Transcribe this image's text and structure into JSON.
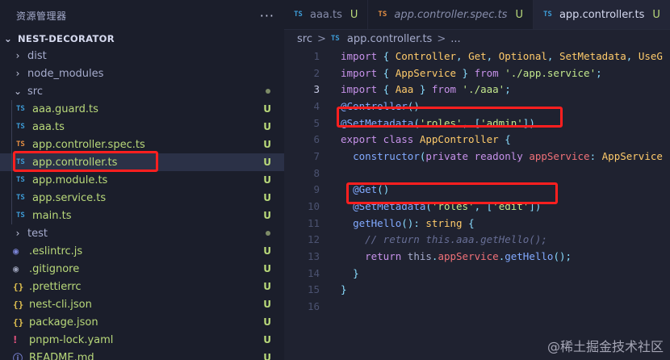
{
  "sidebar": {
    "title": "资源管理器",
    "more": "···",
    "project": "NEST-DECORATOR",
    "items": [
      {
        "label": "dist",
        "kind": "folder",
        "indent": 1
      },
      {
        "label": "node_modules",
        "kind": "folder",
        "indent": 1
      },
      {
        "label": "src",
        "kind": "folder-open",
        "indent": 1,
        "dot": true
      },
      {
        "label": "aaa.guard.ts",
        "kind": "ts",
        "indent": 2,
        "badge": "U"
      },
      {
        "label": "aaa.ts",
        "kind": "ts",
        "indent": 2,
        "badge": "U"
      },
      {
        "label": "app.controller.spec.ts",
        "kind": "tsr",
        "indent": 2,
        "badge": "U"
      },
      {
        "label": "app.controller.ts",
        "kind": "ts",
        "indent": 2,
        "badge": "U",
        "selected": true
      },
      {
        "label": "app.module.ts",
        "kind": "ts",
        "indent": 2,
        "badge": "U"
      },
      {
        "label": "app.service.ts",
        "kind": "ts",
        "indent": 2,
        "badge": "U"
      },
      {
        "label": "main.ts",
        "kind": "ts",
        "indent": 2,
        "badge": "U"
      },
      {
        "label": "test",
        "kind": "folder",
        "indent": 1,
        "dot": true
      },
      {
        "label": ".eslintrc.js",
        "kind": "js",
        "indent": 1,
        "badge": "U"
      },
      {
        "label": ".gitignore",
        "kind": "git",
        "indent": 1,
        "badge": "U"
      },
      {
        "label": ".prettierrc",
        "kind": "brace",
        "indent": 1,
        "badge": "U"
      },
      {
        "label": "nest-cli.json",
        "kind": "brace",
        "indent": 1,
        "badge": "U"
      },
      {
        "label": "package.json",
        "kind": "brace",
        "indent": 1,
        "badge": "U"
      },
      {
        "label": "pnpm-lock.yaml",
        "kind": "yaml",
        "indent": 1,
        "badge": "U"
      },
      {
        "label": "README.md",
        "kind": "md",
        "indent": 1,
        "badge": "U"
      }
    ]
  },
  "tabs": [
    {
      "icon": "TS",
      "label": "aaa.ts",
      "badge": "U",
      "kind": "ts"
    },
    {
      "icon": "TS",
      "label": "app.controller.spec.ts",
      "badge": "U",
      "kind": "tsr",
      "italic": true
    },
    {
      "icon": "TS",
      "label": "app.controller.ts",
      "badge": "U",
      "kind": "ts",
      "active": true
    }
  ],
  "breadcrumb": {
    "folder": "src",
    "sep": ">",
    "file": "app.controller.ts",
    "tail": "..."
  },
  "icons": {
    "ts": "TS",
    "js": "◉",
    "git": "◉",
    "brace": "{}",
    "yaml": "!",
    "md": "ⓘ",
    "chev_closed": "›",
    "chev_open": "⌄"
  },
  "code": {
    "line_numbers": [
      "1",
      "2",
      "3",
      "4",
      "5",
      "6",
      "7",
      "8",
      "9",
      "10",
      "11",
      "12",
      "13",
      "14",
      "15",
      "16"
    ],
    "current_line": "3",
    "lines": [
      [
        [
          "kw",
          "import"
        ],
        [
          "pu",
          " { "
        ],
        [
          "ty",
          "Controller"
        ],
        [
          "pu",
          ", "
        ],
        [
          "ty",
          "Get"
        ],
        [
          "pu",
          ", "
        ],
        [
          "ty",
          "Optional"
        ],
        [
          "pu",
          ", "
        ],
        [
          "ty",
          "SetMetadata"
        ],
        [
          "pu",
          ", "
        ],
        [
          "ty",
          "UseG"
        ]
      ],
      [
        [
          "kw",
          "import"
        ],
        [
          "pu",
          " { "
        ],
        [
          "ty",
          "AppService"
        ],
        [
          "pu",
          " } "
        ],
        [
          "kw",
          "from"
        ],
        [
          "st",
          " './app.service'"
        ],
        [
          "pu",
          ";"
        ]
      ],
      [
        [
          "kw",
          "import"
        ],
        [
          "pu",
          " { "
        ],
        [
          "ty",
          "Aaa"
        ],
        [
          "pu",
          " } "
        ],
        [
          "kw",
          "from"
        ],
        [
          "st",
          " './aaa'"
        ],
        [
          "pu",
          ";"
        ]
      ],
      [
        [
          "fn",
          "@Controller"
        ],
        [
          "pu",
          "()"
        ]
      ],
      [
        [
          "fn",
          "@SetMetadata"
        ],
        [
          "pu",
          "("
        ],
        [
          "st",
          "'roles'"
        ],
        [
          "pu",
          ", ["
        ],
        [
          "st",
          "'admin'"
        ],
        [
          "pu",
          "])"
        ]
      ],
      [
        [
          "kw",
          "export"
        ],
        [
          "kw",
          " class "
        ],
        [
          "ty",
          "AppController"
        ],
        [
          "pu",
          " {"
        ]
      ],
      [
        [
          "ctext",
          "  "
        ],
        [
          "fn",
          "constructor"
        ],
        [
          "pu",
          "("
        ],
        [
          "kw",
          "private readonly "
        ],
        [
          "pr",
          "appService"
        ],
        [
          "pu",
          ": "
        ],
        [
          "ty",
          "AppService"
        ]
      ],
      [],
      [
        [
          "ctext",
          "  "
        ],
        [
          "fn",
          "@Get"
        ],
        [
          "pu",
          "()"
        ]
      ],
      [
        [
          "ctext",
          "  "
        ],
        [
          "fn",
          "@SetMetadata"
        ],
        [
          "pu",
          "("
        ],
        [
          "st",
          "'roles'"
        ],
        [
          "pu",
          ", ["
        ],
        [
          "st",
          "'edit'"
        ],
        [
          "pu",
          "])"
        ]
      ],
      [
        [
          "ctext",
          "  "
        ],
        [
          "fn",
          "getHello"
        ],
        [
          "pu",
          "(): "
        ],
        [
          "ty",
          "string"
        ],
        [
          "pu",
          " {"
        ]
      ],
      [
        [
          "cm",
          "    // return this.aaa.getHello();"
        ]
      ],
      [
        [
          "ctext",
          "    "
        ],
        [
          "kw",
          "return "
        ],
        [
          "ctext",
          "this"
        ],
        [
          "pu",
          "."
        ],
        [
          "pr",
          "appService"
        ],
        [
          "pu",
          "."
        ],
        [
          "fn",
          "getHello"
        ],
        [
          "pu",
          "();"
        ]
      ],
      [
        [
          "ctext",
          "  "
        ],
        [
          "pu",
          "}"
        ]
      ],
      [
        [
          "pu",
          "}"
        ]
      ],
      []
    ]
  },
  "watermark": "@稀土掘金技术社区"
}
